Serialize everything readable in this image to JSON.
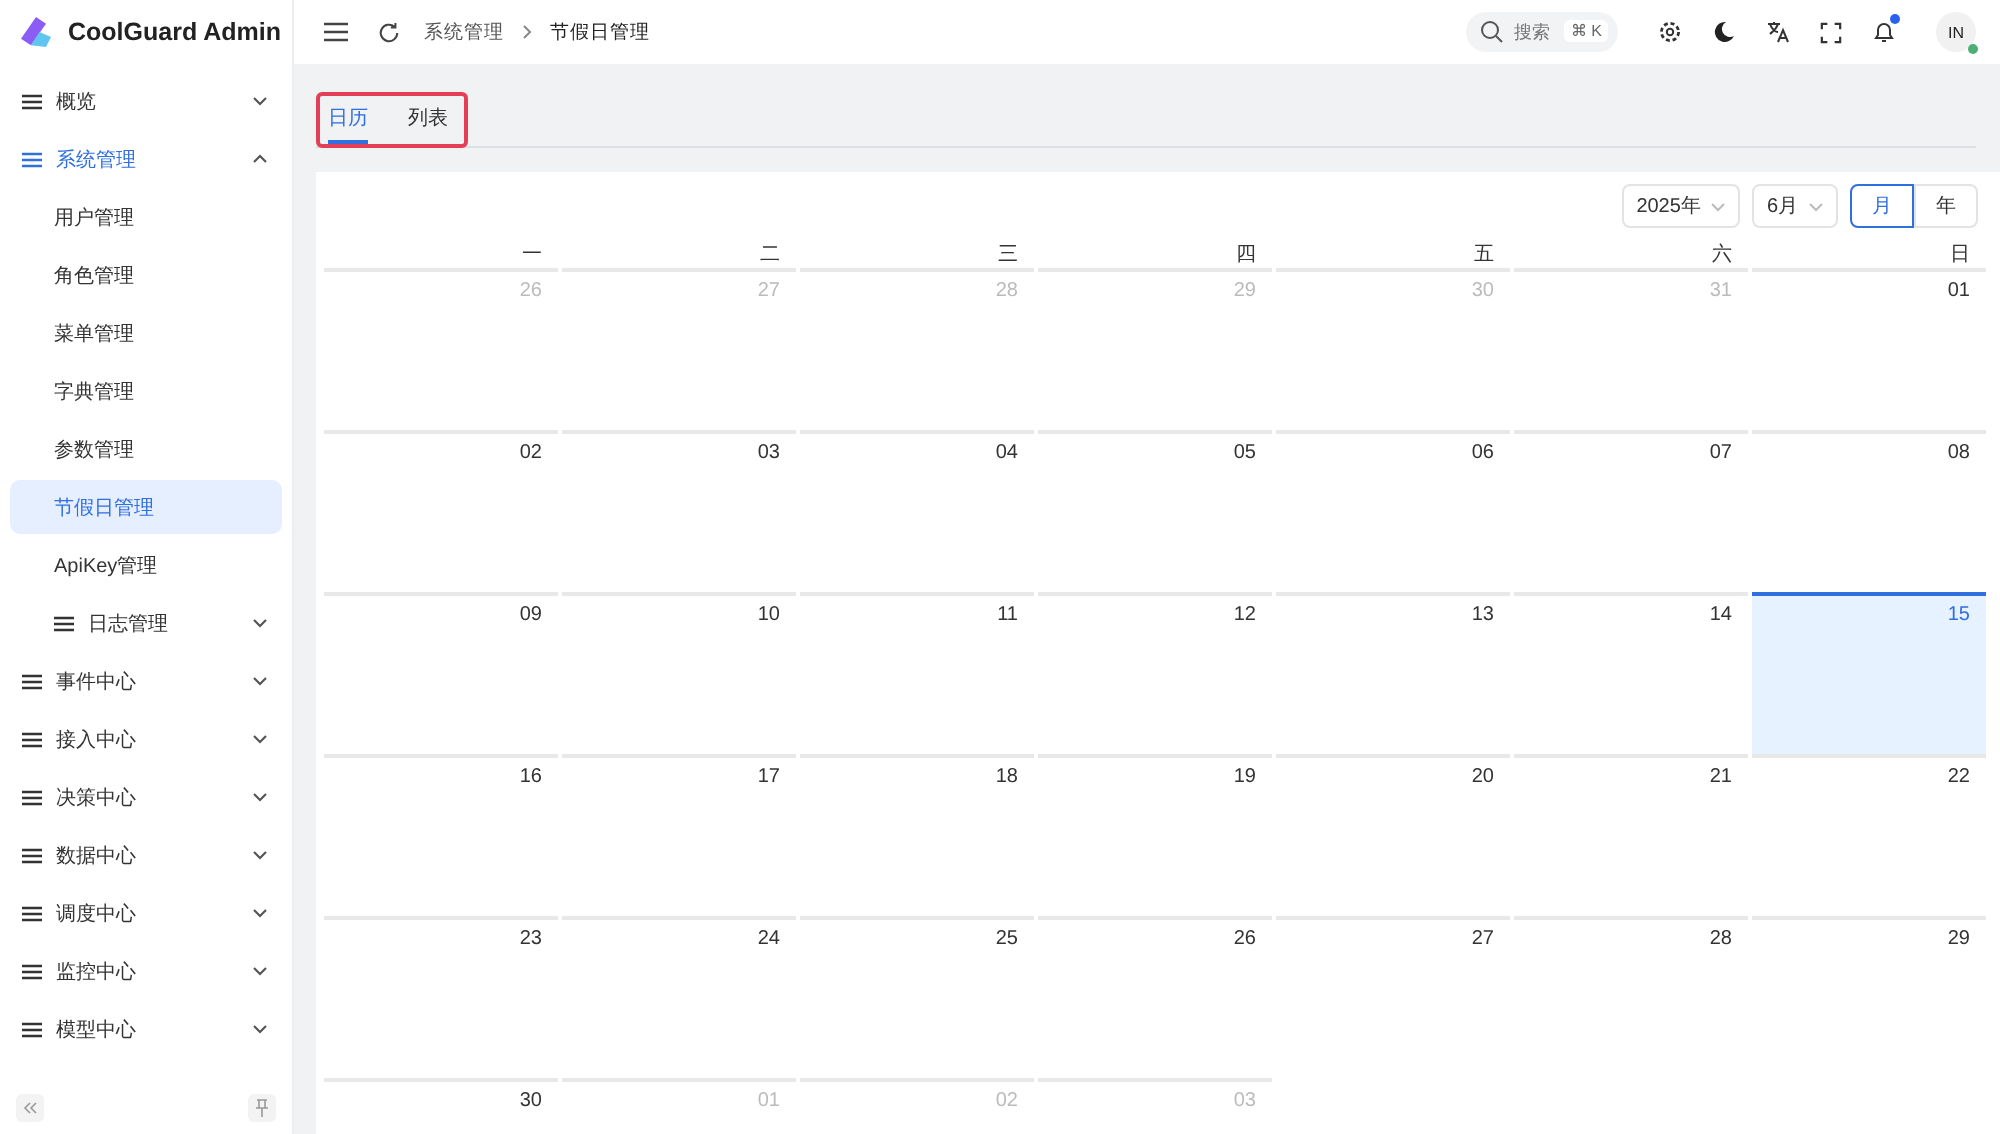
{
  "app": {
    "title": "CoolGuard Admin"
  },
  "sidebar": {
    "items": [
      {
        "label": "概览",
        "expanded": false,
        "selected": false
      },
      {
        "label": "系统管理",
        "expanded": true,
        "selected": false,
        "children": [
          {
            "kind": "link",
            "label": "用户管理",
            "selected": false
          },
          {
            "kind": "link",
            "label": "角色管理",
            "selected": false
          },
          {
            "kind": "link",
            "label": "菜单管理",
            "selected": false
          },
          {
            "kind": "link",
            "label": "字典管理",
            "selected": false
          },
          {
            "kind": "link",
            "label": "参数管理",
            "selected": false
          },
          {
            "kind": "link",
            "label": "节假日管理",
            "selected": true
          },
          {
            "kind": "link",
            "label": "ApiKey管理",
            "selected": false
          },
          {
            "kind": "group",
            "label": "日志管理",
            "selected": false,
            "expanded": false
          }
        ]
      },
      {
        "label": "事件中心",
        "expanded": false,
        "selected": false
      },
      {
        "label": "接入中心",
        "expanded": false,
        "selected": false
      },
      {
        "label": "决策中心",
        "expanded": false,
        "selected": false
      },
      {
        "label": "数据中心",
        "expanded": false,
        "selected": false
      },
      {
        "label": "调度中心",
        "expanded": false,
        "selected": false
      },
      {
        "label": "监控中心",
        "expanded": false,
        "selected": false
      },
      {
        "label": "模型中心",
        "expanded": false,
        "selected": false
      }
    ]
  },
  "header": {
    "breadcrumb": [
      "系统管理",
      "节假日管理"
    ],
    "search": {
      "placeholder": "搜索",
      "shortcut": "⌘ K"
    },
    "notification_unread": true,
    "avatar": {
      "initials": "IN",
      "online": true
    }
  },
  "tabs": [
    {
      "label": "日历",
      "selected": true
    },
    {
      "label": "列表",
      "selected": false
    }
  ],
  "calendar": {
    "year": "2025年",
    "month": "6月",
    "modes": [
      {
        "label": "月",
        "selected": true
      },
      {
        "label": "年",
        "selected": false
      }
    ],
    "weekdays": [
      "一",
      "二",
      "三",
      "四",
      "五",
      "六",
      "日"
    ],
    "weeks": [
      [
        {
          "day": "26",
          "in_month": false,
          "selected": false
        },
        {
          "day": "27",
          "in_month": false,
          "selected": false
        },
        {
          "day": "28",
          "in_month": false,
          "selected": false
        },
        {
          "day": "29",
          "in_month": false,
          "selected": false
        },
        {
          "day": "30",
          "in_month": false,
          "selected": false
        },
        {
          "day": "31",
          "in_month": false,
          "selected": false
        },
        {
          "day": "01",
          "in_month": true,
          "selected": false
        }
      ],
      [
        {
          "day": "02",
          "in_month": true,
          "selected": false
        },
        {
          "day": "03",
          "in_month": true,
          "selected": false
        },
        {
          "day": "04",
          "in_month": true,
          "selected": false
        },
        {
          "day": "05",
          "in_month": true,
          "selected": false
        },
        {
          "day": "06",
          "in_month": true,
          "selected": false
        },
        {
          "day": "07",
          "in_month": true,
          "selected": false
        },
        {
          "day": "08",
          "in_month": true,
          "selected": false
        }
      ],
      [
        {
          "day": "09",
          "in_month": true,
          "selected": false
        },
        {
          "day": "10",
          "in_month": true,
          "selected": false
        },
        {
          "day": "11",
          "in_month": true,
          "selected": false
        },
        {
          "day": "12",
          "in_month": true,
          "selected": false
        },
        {
          "day": "13",
          "in_month": true,
          "selected": false
        },
        {
          "day": "14",
          "in_month": true,
          "selected": false
        },
        {
          "day": "15",
          "in_month": true,
          "selected": true
        }
      ],
      [
        {
          "day": "16",
          "in_month": true,
          "selected": false
        },
        {
          "day": "17",
          "in_month": true,
          "selected": false
        },
        {
          "day": "18",
          "in_month": true,
          "selected": false
        },
        {
          "day": "19",
          "in_month": true,
          "selected": false
        },
        {
          "day": "20",
          "in_month": true,
          "selected": false
        },
        {
          "day": "21",
          "in_month": true,
          "selected": false
        },
        {
          "day": "22",
          "in_month": true,
          "selected": false
        }
      ],
      [
        {
          "day": "23",
          "in_month": true,
          "selected": false
        },
        {
          "day": "24",
          "in_month": true,
          "selected": false
        },
        {
          "day": "25",
          "in_month": true,
          "selected": false
        },
        {
          "day": "26",
          "in_month": true,
          "selected": false
        },
        {
          "day": "27",
          "in_month": true,
          "selected": false
        },
        {
          "day": "28",
          "in_month": true,
          "selected": false
        },
        {
          "day": "29",
          "in_month": true,
          "selected": false
        }
      ],
      [
        {
          "day": "30",
          "in_month": true,
          "selected": false
        },
        {
          "day": "01",
          "in_month": false,
          "selected": false
        },
        {
          "day": "02",
          "in_month": false,
          "selected": false
        },
        {
          "day": "03",
          "in_month": false,
          "selected": false
        }
      ]
    ]
  }
}
